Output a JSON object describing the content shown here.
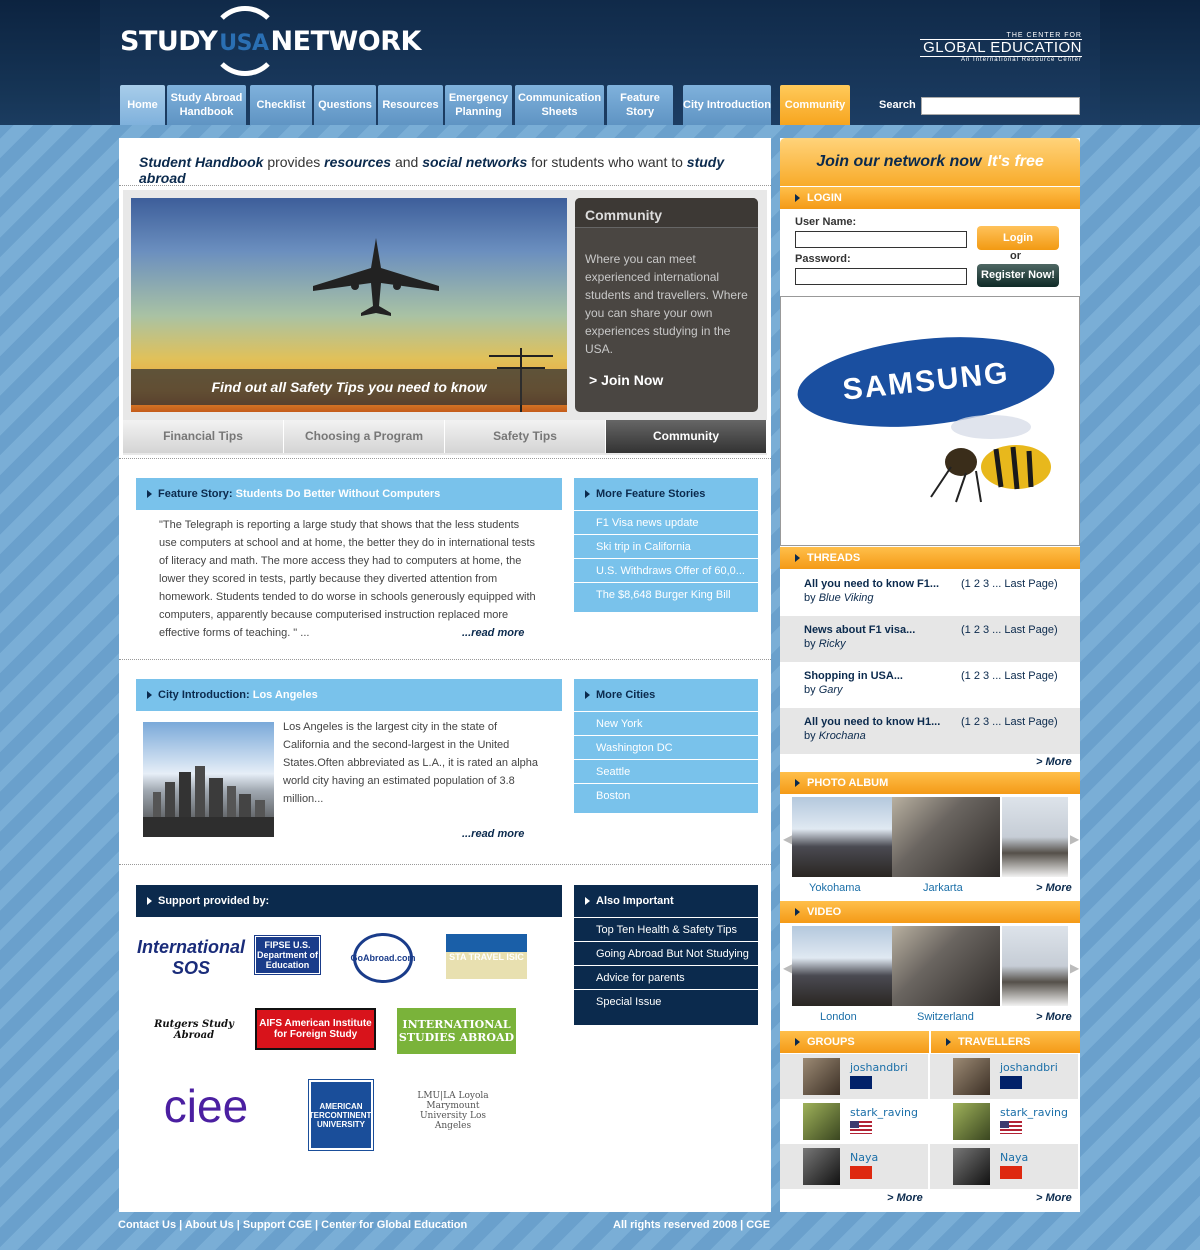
{
  "brand": {
    "logo_left": "STUDY",
    "logo_mid": "USA",
    "logo_right": "NETWORK",
    "cge_line1": "THE CENTER FOR",
    "cge_line2": "GLOBAL EDUCATION",
    "cge_line3": "An International Resource Center"
  },
  "nav": [
    "Home",
    "Study Abroad Handbook",
    "Checklist",
    "Questions",
    "Resources",
    "Emergency Planning",
    "Communication Sheets",
    "Feature Story",
    "City Introduction",
    "Community"
  ],
  "search": {
    "label": "Search",
    "value": ""
  },
  "tagline": {
    "p1": "Student Handbook",
    "p2": " provides ",
    "p3": "resources",
    "p4": " and ",
    "p5": "social networks",
    "p6": " for students who want to ",
    "p7": "study abroad"
  },
  "hero": {
    "caption": "Find out all Safety Tips you need to know",
    "community_title": "Community",
    "community_text": "Where you can meet experienced international students and travellers. Where you can share your own experiences studying in the USA.",
    "join": "> Join Now",
    "tabs": [
      "Financial Tips",
      "Choosing a Program",
      "Safety Tips",
      "Community"
    ]
  },
  "feature": {
    "label": "Feature Story:",
    "title": "Students Do Better Without Computers",
    "text": "\"The Telegraph is reporting a large study that shows that the less students use computers at school and at home, the better they do in international tests of literacy and math. The more access they had to computers at home, the lower they scored in tests, partly because they diverted attention from homework. Students tended to do worse in schools generously equipped with computers, apparently because computerised instruction replaced more effective forms of teaching. \" ...",
    "read_more": "...read more"
  },
  "more_features": {
    "title": "More Feature Stories",
    "items": [
      "F1 Visa news update",
      "Ski trip in California",
      "U.S. Withdraws Offer of 60,0...",
      "The $8,648 Burger King Bill"
    ]
  },
  "city": {
    "label": "City Introduction:",
    "title": "Los Angeles",
    "text": "Los Angeles is the largest city in the state of California and the second-largest in the United States.Often abbreviated as L.A., it is rated an alpha world city having an estimated population of 3.8 million...",
    "read_more": "...read more"
  },
  "more_cities": {
    "title": "More Cities",
    "items": [
      "New York",
      "Washington DC",
      "Seattle",
      "Boston"
    ]
  },
  "support": {
    "title": "Support provided by:",
    "sponsors": [
      "International SOS",
      "FIPSE U.S. Department of Education",
      "GoAbroad.com",
      "STA TRAVEL ISIC",
      "Rutgers Study Abroad",
      "AIFS American Institute for Foreign Study",
      "INTERNATIONAL STUDIES ABROAD",
      "ciee",
      "AMERICAN INTERCONTINENTAL UNIVERSITY",
      "LMU|LA Loyola Marymount University Los Angeles"
    ]
  },
  "also": {
    "title": "Also Important",
    "items": [
      "Top Ten Health & Safety Tips",
      "Going Abroad But Not Studying",
      "Advice for parents",
      "Special Issue"
    ]
  },
  "join": {
    "text": "Join our network now",
    "free": "It's free"
  },
  "login": {
    "title": "LOGIN",
    "user_label": "User Name:",
    "pass_label": "Password:",
    "login_btn": "Login",
    "or": "or",
    "register_btn": "Register Now!"
  },
  "ad": {
    "brand": "SAMSUNG"
  },
  "threads": {
    "title": "THREADS",
    "items": [
      {
        "title": "All you need to know F1...",
        "author": "Blue Viking",
        "pages": "(1 2 3 ... Last Page)"
      },
      {
        "title": "News about F1 visa...",
        "author": "Ricky",
        "pages": "(1 2 3 ... Last Page)"
      },
      {
        "title": "Shopping in USA...",
        "author": "Gary",
        "pages": "(1 2 3 ... Last Page)"
      },
      {
        "title": "All you need to know H1...",
        "author": "Krochana",
        "pages": "(1 2 3 ... Last Page)"
      }
    ],
    "by": "by",
    "more": "> More"
  },
  "photos": {
    "title": "PHOTO ALBUM",
    "captions": [
      "Yokohama",
      "Jarkarta"
    ],
    "more": "> More"
  },
  "video": {
    "title": "VIDEO",
    "captions": [
      "London",
      "Switzerland"
    ],
    "more": "> More"
  },
  "groups": {
    "title": "GROUPS",
    "members": [
      {
        "name": "joshandbri",
        "flag": "australia-flag"
      },
      {
        "name": "stark_raving",
        "flag": "usa-flag"
      },
      {
        "name": "Naya",
        "flag": "china-flag"
      }
    ],
    "more": "> More"
  },
  "travellers": {
    "title": "TRAVELLERS",
    "members": [
      {
        "name": "joshandbri",
        "flag": "australia-flag"
      },
      {
        "name": "stark_raving",
        "flag": "usa-flag"
      },
      {
        "name": "Naya",
        "flag": "china-flag"
      }
    ],
    "more": "> More"
  },
  "footer": {
    "links": "Contact Us | About Us | Support CGE | Center for Global Education",
    "rights": "All rights reserved 2008 | CGE"
  }
}
